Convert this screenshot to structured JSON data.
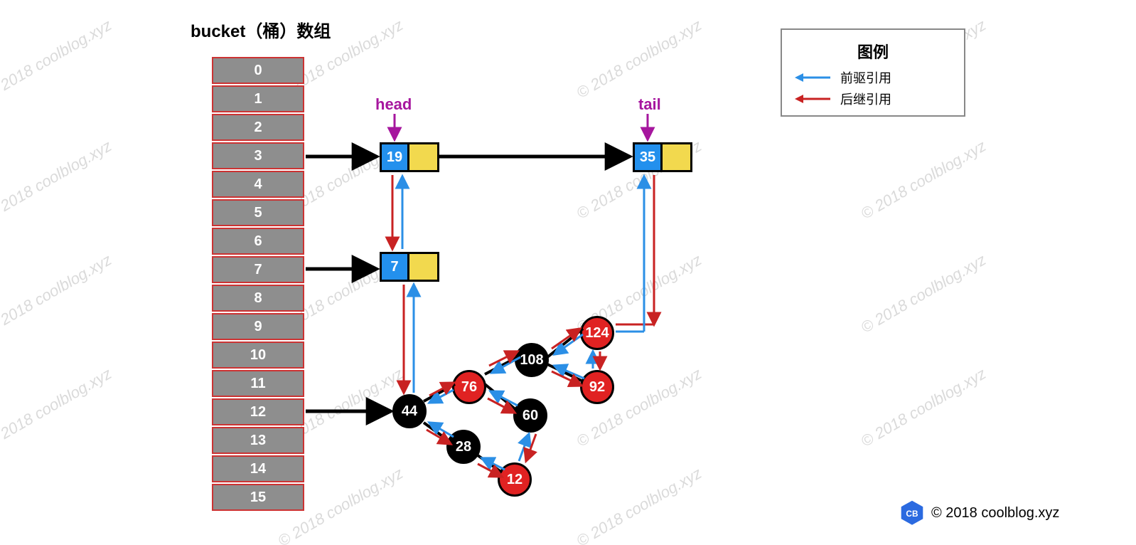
{
  "watermark": "© 2018 coolblog.xyz",
  "title": "bucket（桶）数组",
  "bucket_indices": [
    "0",
    "1",
    "2",
    "3",
    "4",
    "5",
    "6",
    "7",
    "8",
    "9",
    "10",
    "11",
    "12",
    "13",
    "14",
    "15"
  ],
  "labels": {
    "head": "head",
    "tail": "tail"
  },
  "linked_cells": {
    "head": "19",
    "tail": "35",
    "mid": "7"
  },
  "tree_nodes": {
    "n44": {
      "value": "44",
      "color": "black"
    },
    "n28": {
      "value": "28",
      "color": "black"
    },
    "n76": {
      "value": "76",
      "color": "red"
    },
    "n12": {
      "value": "12",
      "color": "red"
    },
    "n60": {
      "value": "60",
      "color": "black"
    },
    "n108": {
      "value": "108",
      "color": "black"
    },
    "n92": {
      "value": "92",
      "color": "red"
    },
    "n124": {
      "value": "124",
      "color": "red"
    }
  },
  "legend": {
    "title": "图例",
    "prev": "前驱引用",
    "next": "后继引用"
  },
  "colors": {
    "prev_arrow": "#2b8fe6",
    "next_arrow": "#c82222",
    "label_purple": "#a6169e"
  },
  "footer": "© 2018 coolblog.xyz",
  "badge_text": "CB"
}
